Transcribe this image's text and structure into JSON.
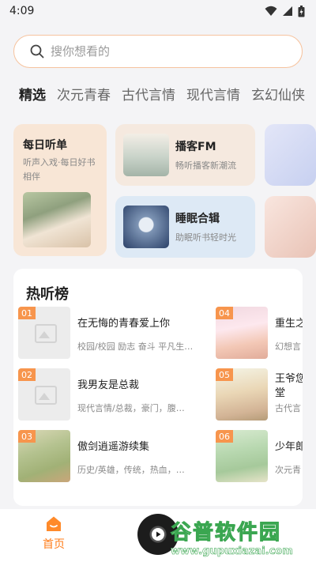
{
  "status_bar": {
    "time": "4:09",
    "icons": [
      "wifi-icon",
      "signal-icon",
      "battery-icon"
    ]
  },
  "search": {
    "placeholder": "搜你想看的"
  },
  "tabs": [
    {
      "label": "精选",
      "active": true
    },
    {
      "label": "次元青春",
      "active": false
    },
    {
      "label": "古代言情",
      "active": false
    },
    {
      "label": "现代言情",
      "active": false
    },
    {
      "label": "玄幻仙侠",
      "active": false
    }
  ],
  "cards": {
    "daily": {
      "title": "每日听单",
      "subtitle": "听声入戏·每日好书相伴"
    },
    "podcast": {
      "title": "播客FM",
      "subtitle": "畅听播客新潮流"
    },
    "sleep": {
      "title": "睡眠合辑",
      "subtitle": "助眠听书轻时光"
    }
  },
  "hot_list": {
    "title": "热听榜",
    "items": [
      {
        "rank": "01",
        "title": "在无悔的青春爱上你",
        "tags": "校园/校园 励志 奋斗 平凡生…"
      },
      {
        "rank": "02",
        "title": "我男友是总裁",
        "tags": "现代言情/总裁，豪门，腹…"
      },
      {
        "rank": "03",
        "title": "傲剑逍遥游续集",
        "tags": "历史/英雄，传统，热血，…"
      },
      {
        "rank": "04",
        "title": "重生之",
        "tags": "幻想言"
      },
      {
        "rank": "05",
        "title": "王爷您",
        "title_line2": "堂",
        "tags": "古代言"
      },
      {
        "rank": "06",
        "title": "少年郎",
        "tags": "次元青"
      }
    ]
  },
  "bottom_nav": {
    "home_label": "首页"
  },
  "watermark": {
    "main": "谷普软件园",
    "url": "www.gupuxiazai.com"
  },
  "colors": {
    "accent": "#ff8a2a",
    "rank_badge": "#f7954d",
    "search_border": "#f6c39e"
  }
}
